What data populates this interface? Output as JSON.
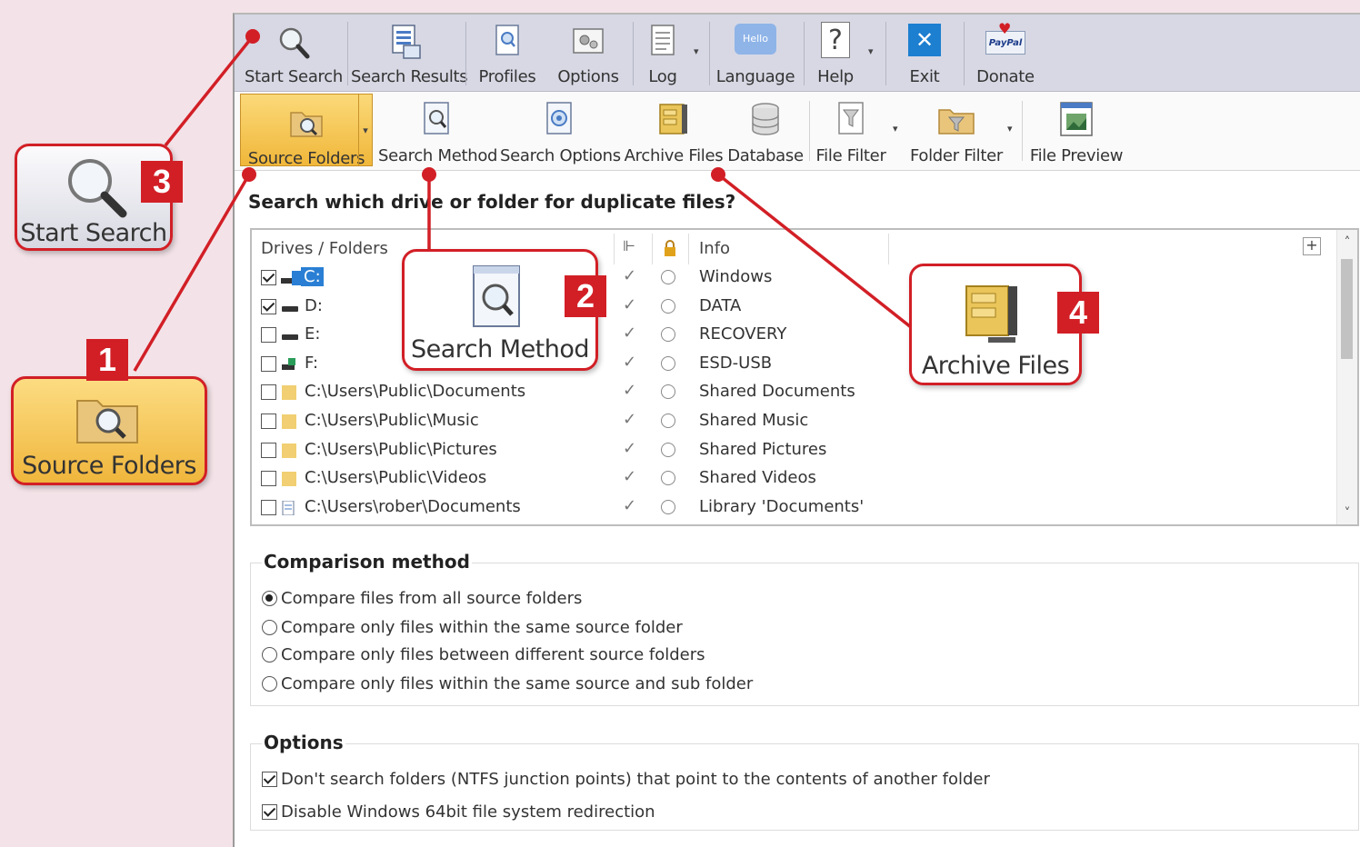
{
  "toolbar_main": {
    "items": [
      {
        "label": "Start Search",
        "icon": "magnifier-icon"
      },
      {
        "label": "Search Results",
        "icon": "results-icon"
      },
      {
        "label": "Profiles",
        "icon": "profiles-icon"
      },
      {
        "label": "Options",
        "icon": "options-icon"
      },
      {
        "label": "Log",
        "icon": "log-icon"
      },
      {
        "label": "Language",
        "icon": "language-icon",
        "bubble": "Hello"
      },
      {
        "label": "Help",
        "icon": "help-icon",
        "glyph": "?"
      },
      {
        "label": "Exit",
        "icon": "exit-icon",
        "glyph": "✕"
      },
      {
        "label": "Donate",
        "icon": "paypal-icon",
        "bubble": "PayPal"
      }
    ]
  },
  "toolbar_sub": {
    "items": [
      {
        "label": "Source Folders",
        "icon": "folder-search-icon",
        "active": true
      },
      {
        "label": "Search Method",
        "icon": "search-method-icon"
      },
      {
        "label": "Search Options",
        "icon": "search-options-icon"
      },
      {
        "label": "Archive Files",
        "icon": "archive-icon"
      },
      {
        "label": "Database",
        "icon": "database-icon"
      },
      {
        "label": "File Filter",
        "icon": "file-filter-icon"
      },
      {
        "label": "Folder Filter",
        "icon": "folder-filter-icon"
      },
      {
        "label": "File Preview",
        "icon": "file-preview-icon"
      }
    ]
  },
  "question": "Search which drive or folder for duplicate files?",
  "list": {
    "headers": {
      "drives": "Drives / Folders",
      "info": "Info"
    },
    "rows": [
      {
        "path": "C:",
        "info": "Windows",
        "checked": true,
        "icon": "system-drive-icon"
      },
      {
        "path": "D:",
        "info": "DATA",
        "checked": true,
        "icon": "drive-icon"
      },
      {
        "path": "E:",
        "info": "RECOVERY",
        "checked": false,
        "icon": "drive-icon"
      },
      {
        "path": "F:",
        "info": "ESD-USB",
        "checked": false,
        "icon": "usb-drive-icon"
      },
      {
        "path": "C:\\Users\\Public\\Documents",
        "info": "Shared Documents",
        "checked": false,
        "icon": "folder-icon"
      },
      {
        "path": "C:\\Users\\Public\\Music",
        "info": "Shared Music",
        "checked": false,
        "icon": "folder-icon"
      },
      {
        "path": "C:\\Users\\Public\\Pictures",
        "info": "Shared Pictures",
        "checked": false,
        "icon": "folder-icon"
      },
      {
        "path": "C:\\Users\\Public\\Videos",
        "info": "Shared Videos",
        "checked": false,
        "icon": "folder-icon"
      },
      {
        "path": "C:\\Users\\rober\\Documents",
        "info": "Library 'Documents'",
        "checked": false,
        "icon": "library-icon"
      }
    ]
  },
  "comparison": {
    "title": "Comparison method",
    "options": [
      {
        "label": "Compare files from all source folders",
        "selected": true
      },
      {
        "label": "Compare only files within the same source folder",
        "selected": false
      },
      {
        "label": "Compare only files between different source folders",
        "selected": false
      },
      {
        "label": "Compare only files within the same source and sub folder",
        "selected": false
      }
    ]
  },
  "options": {
    "title": "Options",
    "items": [
      {
        "label": "Don't search folders (NTFS junction points) that point to the contents of another folder",
        "checked": true
      },
      {
        "label": "Disable Windows 64bit file system redirection",
        "checked": true
      }
    ]
  },
  "callouts": [
    {
      "number": "1",
      "label": "Source Folders"
    },
    {
      "number": "2",
      "label": "Search Method"
    },
    {
      "number": "3",
      "label": "Start Search"
    },
    {
      "number": "4",
      "label": "Archive Files"
    }
  ],
  "colors": {
    "accent": "#d21f26",
    "active_button": "#f5c24c",
    "toolbar": "#d7d8e4",
    "background": "#f3e3e8"
  }
}
